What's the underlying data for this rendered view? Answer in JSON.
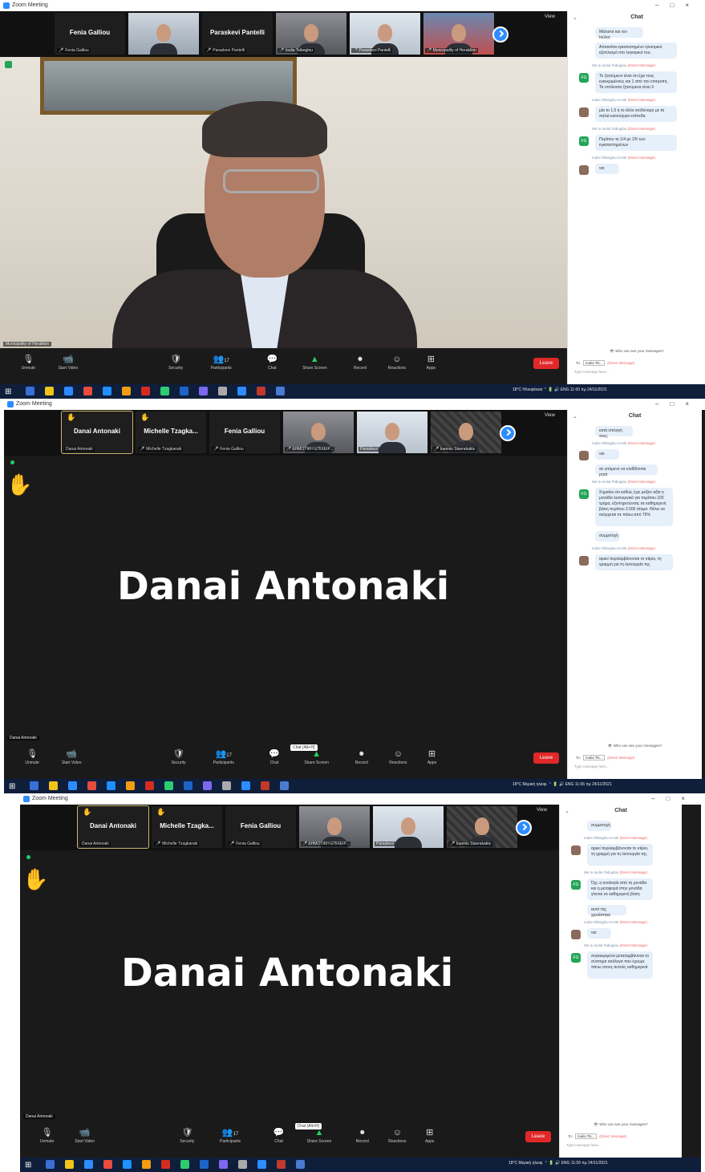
{
  "app": {
    "title": "Zoom Meeting",
    "window_controls": [
      "–",
      "□",
      "×"
    ]
  },
  "view_label": "View",
  "screenshots": [
    {
      "thumbnails": [
        {
          "kind": "name",
          "name": "Fenia Galliou",
          "caption": "Fenia Galliou",
          "muted": true
        },
        {
          "kind": "video",
          "caption": "",
          "room": "room1"
        },
        {
          "kind": "name",
          "name": "Paraskevi Pantelli",
          "caption": "Paraskevi Pantelli",
          "muted": true
        },
        {
          "kind": "video",
          "caption": "Ioulia Tsiboglou",
          "room": "room2",
          "muted": true
        },
        {
          "kind": "video",
          "caption": "Paraskevi Pantelli",
          "room": "room3",
          "muted": true
        },
        {
          "kind": "video",
          "caption": "Municipality of Heraklion",
          "room": "room4",
          "muted": true
        }
      ],
      "speaker_label": "Municipality of Heraklion",
      "chat": [
        {
          "type": "msg",
          "text": "Μάλιστα και τον Ιούλιο;"
        },
        {
          "type": "msg",
          "text": "Απαιτείται εγκατεστημένο ηλεκτρικό εξοπλισμό στο λογισμικό του;"
        },
        {
          "type": "meta",
          "from": "Me to Ioulia Tsiboglou",
          "pm": "(Direct Message)"
        },
        {
          "type": "msg",
          "av": "FG",
          "text": "Το ζητούμενο είναι ότι έχει τους εγκεκριμένους και 1 από την επιτροπή. Τα υπόλοιπα ζητούμενα είναι 3"
        },
        {
          "type": "meta",
          "from": "Ioulia Tsiboglou to Me",
          "pm": "(Direct Message)"
        },
        {
          "type": "msg",
          "av": "ph",
          "text": "μία το 1,5 ή το άλλο ισοδύναμο με τα παλιά καινούργια επίπεδα"
        },
        {
          "type": "meta",
          "from": "Me to Ioulia Tsiboglou",
          "pm": "(Direct Message)"
        },
        {
          "type": "msg",
          "av": "FG",
          "text": "Περίπου το 1/4 με 1/5 των εγκατεστημένων"
        },
        {
          "type": "meta",
          "from": "Ioulia Tsiboglou to Me",
          "pm": "(Direct Message)"
        },
        {
          "type": "msg",
          "av": "ph",
          "text": "ναι"
        }
      ],
      "who_can_see": "Who can see your messages?",
      "to_label": "To:",
      "to_value": "Ioulia Tsi...",
      "to_pm": "(Direct Message)",
      "type_placeholder": "Type message here...",
      "toolbar": [
        "Unmute",
        "Start Video",
        "Security",
        "Participants",
        "Chat",
        "Share Screen",
        "Record",
        "Reactions",
        "Apps"
      ],
      "participants_count": "17",
      "leave": "Leave",
      "tray": {
        "weather": "18°C Ηλιοφάνεια",
        "time": "11:00 πμ",
        "date": "24/11/2021"
      }
    },
    {
      "thumbnails": [
        {
          "kind": "name",
          "name": "Danai Antonaki",
          "caption": "Danai Antonaki",
          "hand": true,
          "active": true
        },
        {
          "kind": "name",
          "name": "Michelle Tzagka...",
          "caption": "Michelle Tzagkaraki",
          "hand": true,
          "muted": true
        },
        {
          "kind": "name",
          "name": "Fenia Galliou",
          "caption": "Fenia Galliou",
          "muted": true
        },
        {
          "kind": "video",
          "caption": "ΔΗΜΟΤΙΚΗ ΕΠΙΧΕΙΡ...",
          "room": "room2",
          "muted": true
        },
        {
          "kind": "video",
          "caption": "Paraskevi",
          "room": "room3"
        },
        {
          "kind": "video",
          "caption": "Ioannis Stavrakakis",
          "room": "room5",
          "muted": true
        }
      ],
      "big_name": "Danai Antonaki",
      "speaker_label": "Danai Antonaki",
      "chat": [
        {
          "type": "msg",
          "text": "κατά επιλογή τους;"
        },
        {
          "type": "meta",
          "from": "Ioulia Tsiboglou to Me",
          "pm": "(Direct Message)"
        },
        {
          "type": "msg",
          "av": "ph",
          "text": "ναι"
        },
        {
          "type": "msg",
          "text": "σε επόμενο να επιδίδονται ρητά"
        },
        {
          "type": "meta",
          "from": "Me to Ioulia Tsiboglou",
          "pm": "(Direct Message)"
        },
        {
          "type": "msg",
          "av": "FG",
          "text": "Σημαίνει ότι καθώς έχει μείζον αξία η μονάδα λειτουργικό για περίπου 220 τμήμα, εξυπηρετώντας σε καθημερινή βάση περίπου 2.500 άτομα. Θέλει να ανέρχεται σε πάνω από 75%"
        },
        {
          "type": "msg",
          "text": "συμμετοχή"
        },
        {
          "type": "meta",
          "from": "Ioulia Tsiboglou to Me",
          "pm": "(Direct Message)"
        },
        {
          "type": "msg",
          "av": "ph",
          "text": "αρκεί περιλαμβάνονται το κτίριο, τη γραμμή για τη λειτουργία της"
        }
      ],
      "who_can_see": "Who can see your messages?",
      "to_label": "To:",
      "to_value": "Ioulia Tsi...",
      "to_pm": "(Direct Message)",
      "type_placeholder": "Type message here...",
      "toolbar": [
        "Unmute",
        "Start Video",
        "Security",
        "Participants",
        "Chat",
        "Share Screen",
        "Record",
        "Reactions",
        "Apps"
      ],
      "participants_count": "17",
      "tooltip": "Chat (Alt+H)",
      "leave": "Leave",
      "tray": {
        "weather": "18°C Μερική ηλιοφ.",
        "time": "11:06 πμ",
        "date": "24/11/2021"
      }
    },
    {
      "thumbnails": [
        {
          "kind": "name",
          "name": "Danai Antonaki",
          "caption": "Danai Antonaki",
          "hand": true,
          "active": true
        },
        {
          "kind": "name",
          "name": "Michelle Tzagka...",
          "caption": "Michelle Tzagkaraki",
          "hand": true,
          "muted": true
        },
        {
          "kind": "name",
          "name": "Fenia Galliou",
          "caption": "Fenia Galliou",
          "muted": true
        },
        {
          "kind": "video",
          "caption": "ΔΗΜΟΤΙΚΗ ΕΠΙΧΕΙΡ...",
          "room": "room2",
          "muted": true
        },
        {
          "kind": "video",
          "caption": "Paraskevi",
          "room": "room3"
        },
        {
          "kind": "video",
          "caption": "Ioannis Stavrakakis",
          "room": "room5",
          "muted": true
        }
      ],
      "big_name": "Danai Antonaki",
      "speaker_label": "Danai Antonaki",
      "chat": [
        {
          "type": "msg",
          "text": "συμμετοχή"
        },
        {
          "type": "meta",
          "from": "Ioulia Tsiboglou to Me",
          "pm": "(Direct Message)"
        },
        {
          "type": "msg",
          "av": "ph",
          "text": "αρκεί περιλαμβάνονται το κτίριο, τη γραμμή για τη λειτουργία της"
        },
        {
          "type": "meta",
          "from": "Me to Ioulia Tsiboglou",
          "pm": "(Direct Message)"
        },
        {
          "type": "msg",
          "av": "FG",
          "text": "Όχι, η αναλογία από τη μονάδα και η μεταφορά στην μονάδα γίνεται σε καθημερινή βάση"
        },
        {
          "type": "msg",
          "text": "αυτό της χρειάστηκε"
        },
        {
          "type": "meta",
          "from": "Ioulia Tsiboglou to Me",
          "pm": "(Direct Message)"
        },
        {
          "type": "msg",
          "av": "ph",
          "text": "ναι"
        },
        {
          "type": "meta",
          "from": "Me to Ioulia Tsiboglou",
          "pm": "(Direct Message)"
        },
        {
          "type": "msg",
          "av": "FG",
          "text": "συγκεκριμένα μεταλαμβάνεται το σύστημα ανάλογα που έχουμε πάνω στους αυτούς καθημερινά"
        }
      ],
      "who_can_see": "Who can see your messages?",
      "to_label": "To:",
      "to_value": "Ioulia Tsi...",
      "to_pm": "(Direct Message)",
      "type_placeholder": "Type message here...",
      "toolbar": [
        "Unmute",
        "Start Video",
        "Security",
        "Participants",
        "Chat",
        "Share Screen",
        "Record",
        "Reactions",
        "Apps"
      ],
      "participants_count": "17",
      "tooltip": "Chat (Alt+H)",
      "leave": "Leave",
      "tray": {
        "weather": "18°C Μερική ηλιοφ.",
        "time": "11:09 πμ",
        "date": "24/11/2021"
      }
    }
  ]
}
